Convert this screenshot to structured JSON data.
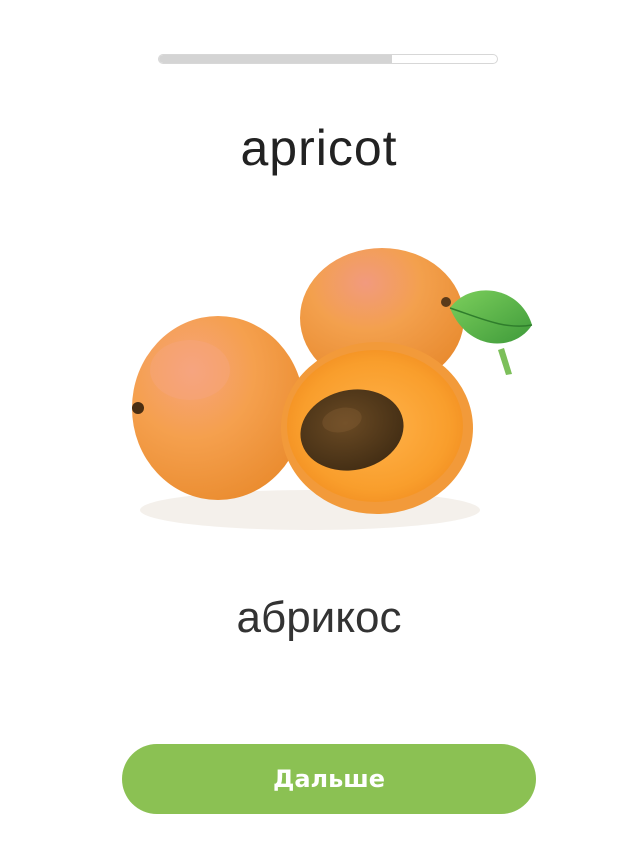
{
  "progress": {
    "value": 0.69
  },
  "card": {
    "word": "apricot",
    "image": "apricot-fruit-image",
    "translation": "абрикос"
  },
  "actions": {
    "next_label": "Дальше"
  },
  "colors": {
    "accent": "#8bc153",
    "progress_fill": "#d4d4d4",
    "progress_border": "#d7d7d7",
    "text": "#222222"
  }
}
